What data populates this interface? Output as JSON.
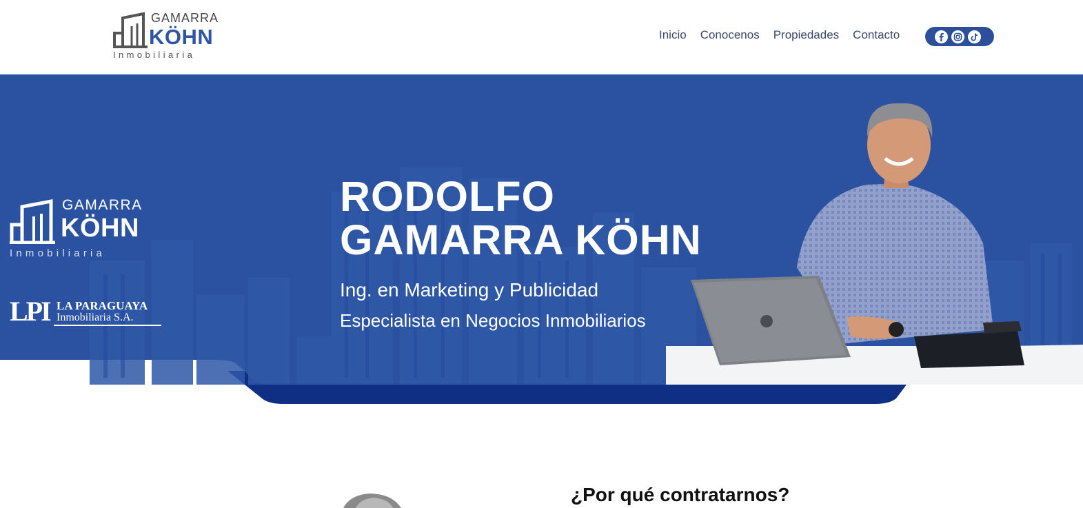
{
  "brand": {
    "top": "GAMARRA",
    "main": "KÖHN",
    "sub": "Inmobiliaria",
    "color": "#2f55a4"
  },
  "nav": {
    "items": [
      "Inicio",
      "Conocenos",
      "Propiedades",
      "Contacto"
    ]
  },
  "social": {
    "icons": [
      "facebook-icon",
      "instagram-icon",
      "tiktok-icon"
    ],
    "background": "#2c4f9c"
  },
  "hero": {
    "background": "#2a52a0",
    "logo": {
      "top": "GAMARRA",
      "main": "KÖHN",
      "sub": "Inmobiliaria"
    },
    "partner": {
      "mark": "LPI",
      "line1": "LA PARAGUAYA",
      "line2": "Inmobiliaria S.A."
    },
    "title_line1": "RODOLFO",
    "title_line2": "GAMARRA KÖHN",
    "subtitle1": "Ing. en Marketing y Publicidad",
    "subtitle2": "Especialista en Negocios Inmobiliarios"
  },
  "section": {
    "title": "¿Por qué contratarnos?"
  }
}
